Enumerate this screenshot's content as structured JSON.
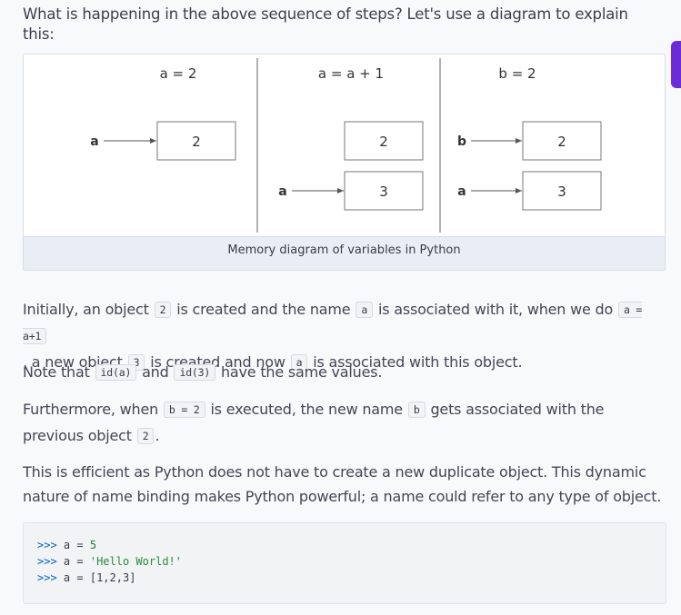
{
  "intro": "What is happening in the above sequence of steps? Let's use a diagram to explain this:",
  "figure": {
    "caption": "Memory diagram of variables in Python",
    "panels": [
      {
        "title": "a = 2",
        "rows": [
          {
            "name": "a",
            "value": "2"
          }
        ]
      },
      {
        "title": "a = a + 1",
        "rows": [
          {
            "name": "",
            "value": "2"
          },
          {
            "name": "a",
            "value": "3"
          }
        ]
      },
      {
        "title": "b = 2",
        "rows": [
          {
            "name": "b",
            "value": "2"
          },
          {
            "name": "a",
            "value": "3"
          }
        ]
      }
    ]
  },
  "p1": {
    "t1": "Initially, an object",
    "c1": "2",
    "t2": "is created and the name",
    "c2": "a",
    "t3": "is associated with it, when we do",
    "c3": "a = a+1",
    "t4": ", a new object",
    "c4": "3",
    "t5": "is created and now",
    "c5": "a",
    "t6": "is associated with this object."
  },
  "p2": {
    "t1": "Note that",
    "c1": "id(a)",
    "t2": "and",
    "c2": "id(3)",
    "t3": "have the same values."
  },
  "p3": {
    "t1": "Furthermore, when",
    "c1": "b = 2",
    "t2": "is executed, the new name",
    "c2": "b",
    "t3": "gets associated with the previous object",
    "c3": "2",
    "t4": "."
  },
  "p4": "This is efficient as Python does not have to create a new duplicate object. This dynamic nature of name binding makes Python powerful; a name could refer to any type of object.",
  "code": {
    "lines": [
      {
        "prompt": ">>>",
        "lhs": "a",
        "op": "=",
        "rhs": "5",
        "kind": "num"
      },
      {
        "prompt": ">>>",
        "lhs": "a",
        "op": "=",
        "rhs": "'Hello World!'",
        "kind": "str"
      },
      {
        "prompt": ">>>",
        "lhs": "a",
        "op": "=",
        "rhs": "[1,2,3]",
        "kind": "op"
      }
    ]
  },
  "colors": {
    "accent_tab": "#6c2bd9",
    "caption_band": "#e9eef6"
  }
}
